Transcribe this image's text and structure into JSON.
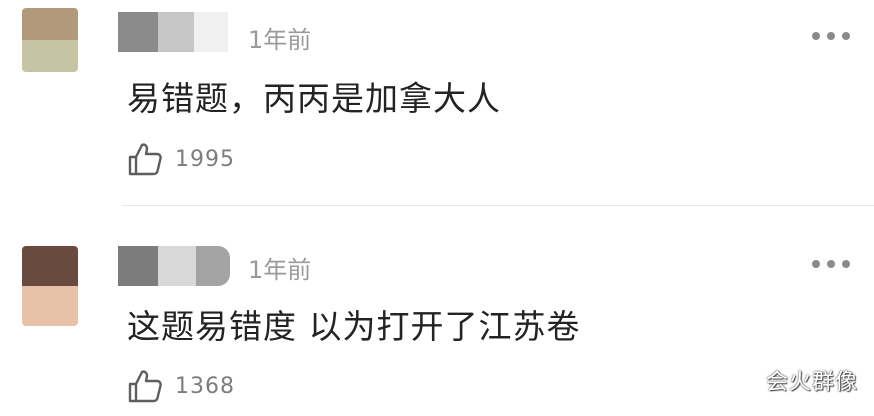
{
  "comments": [
    {
      "timestamp": "1年前",
      "text": "易错题，丙丙是加拿大人",
      "likes": "1995",
      "avatar_colors": [
        "#b09a7a",
        "#c7c4a4"
      ],
      "name_blur_colors": [
        "#8a8a8a",
        "#c6c6c6",
        "#f0f0f0"
      ]
    },
    {
      "timestamp": "1年前",
      "text": "这题易错度 以为打开了江苏卷",
      "likes": "1368",
      "avatar_colors": [
        "#6a4a3e",
        "#e8c2a8"
      ],
      "name_blur_colors": [
        "#7c7c7c",
        "#d8d8d8",
        "#a4a4a4"
      ]
    }
  ],
  "watermark": "会火群像",
  "icons": {
    "like": "thumbs-up-icon",
    "more": "more-dots-icon"
  }
}
